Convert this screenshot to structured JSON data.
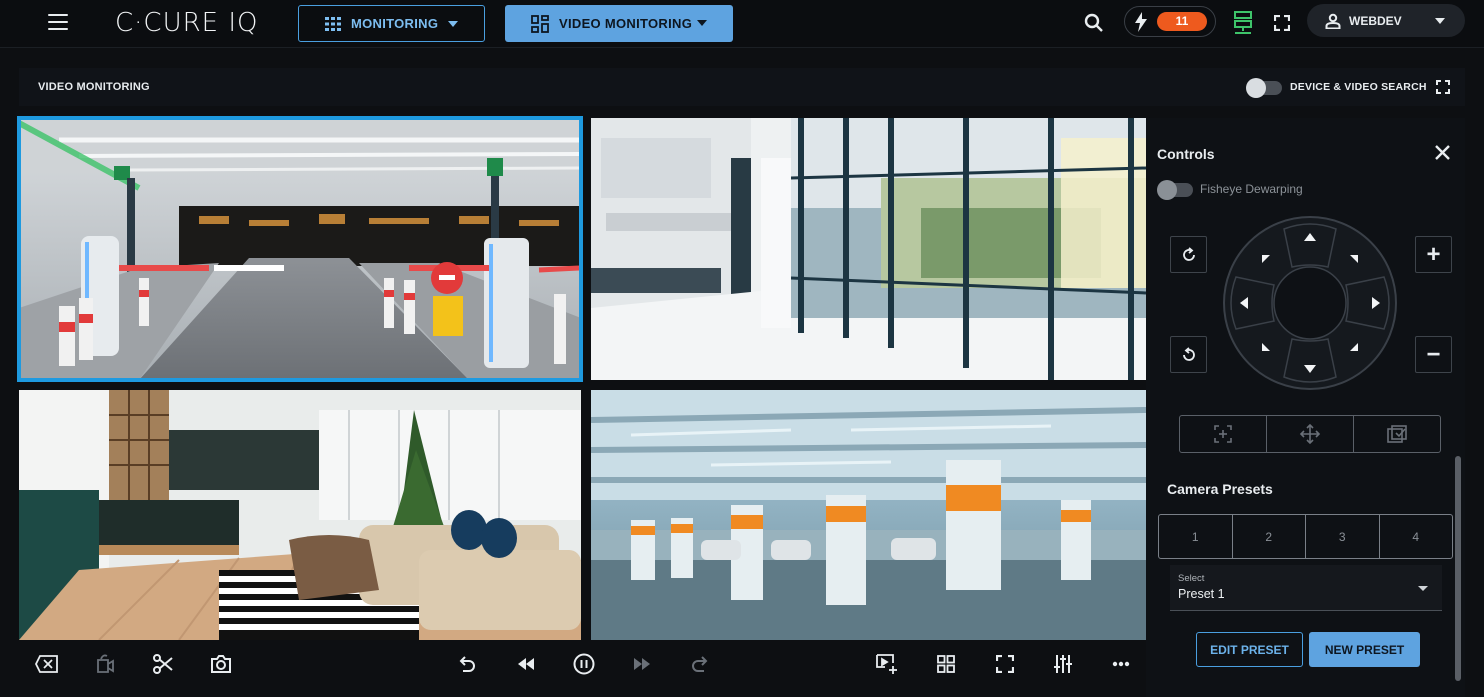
{
  "app": {
    "logo": "C·CURE IQ",
    "nav_monitoring": "MONITORING",
    "nav_video_monitoring": "VIDEO MONITORING",
    "alert_count": "11",
    "user_name": "WEBDEV",
    "accent_color": "#5ea3e0",
    "alert_color": "#ee5a1e"
  },
  "page": {
    "title": "VIDEO MONITORING",
    "device_video_search_label": "DEVICE & VIDEO SEARCH",
    "device_video_search_on": false
  },
  "tiles": [
    {
      "scene": "parking-entrance-barriers",
      "selected": true
    },
    {
      "scene": "bright-atrium-windows",
      "selected": false
    },
    {
      "scene": "hotel-lobby-lounge",
      "selected": false
    },
    {
      "scene": "parking-garage-pillars",
      "selected": false
    }
  ],
  "controls": {
    "title": "Controls",
    "fisheye_label": "Fisheye Dewarping",
    "fisheye_on": false,
    "zoom_in": "+",
    "zoom_out": "−"
  },
  "presets": {
    "title": "Camera Presets",
    "buttons": [
      "1",
      "2",
      "3",
      "4"
    ],
    "select_label": "Select",
    "select_value": "Preset 1",
    "edit_label": "EDIT PRESET",
    "new_label": "NEW PRESET"
  },
  "toolbar": {
    "icons": [
      "close-stream-icon",
      "camera-off-icon",
      "scissors-icon",
      "snapshot-icon",
      "undo-icon",
      "rewind-icon",
      "pause-icon",
      "fast-forward-icon",
      "redo-icon",
      "add-view-icon",
      "grid-layout-icon",
      "fullscreen-icon",
      "sliders-icon",
      "more-icon"
    ]
  }
}
